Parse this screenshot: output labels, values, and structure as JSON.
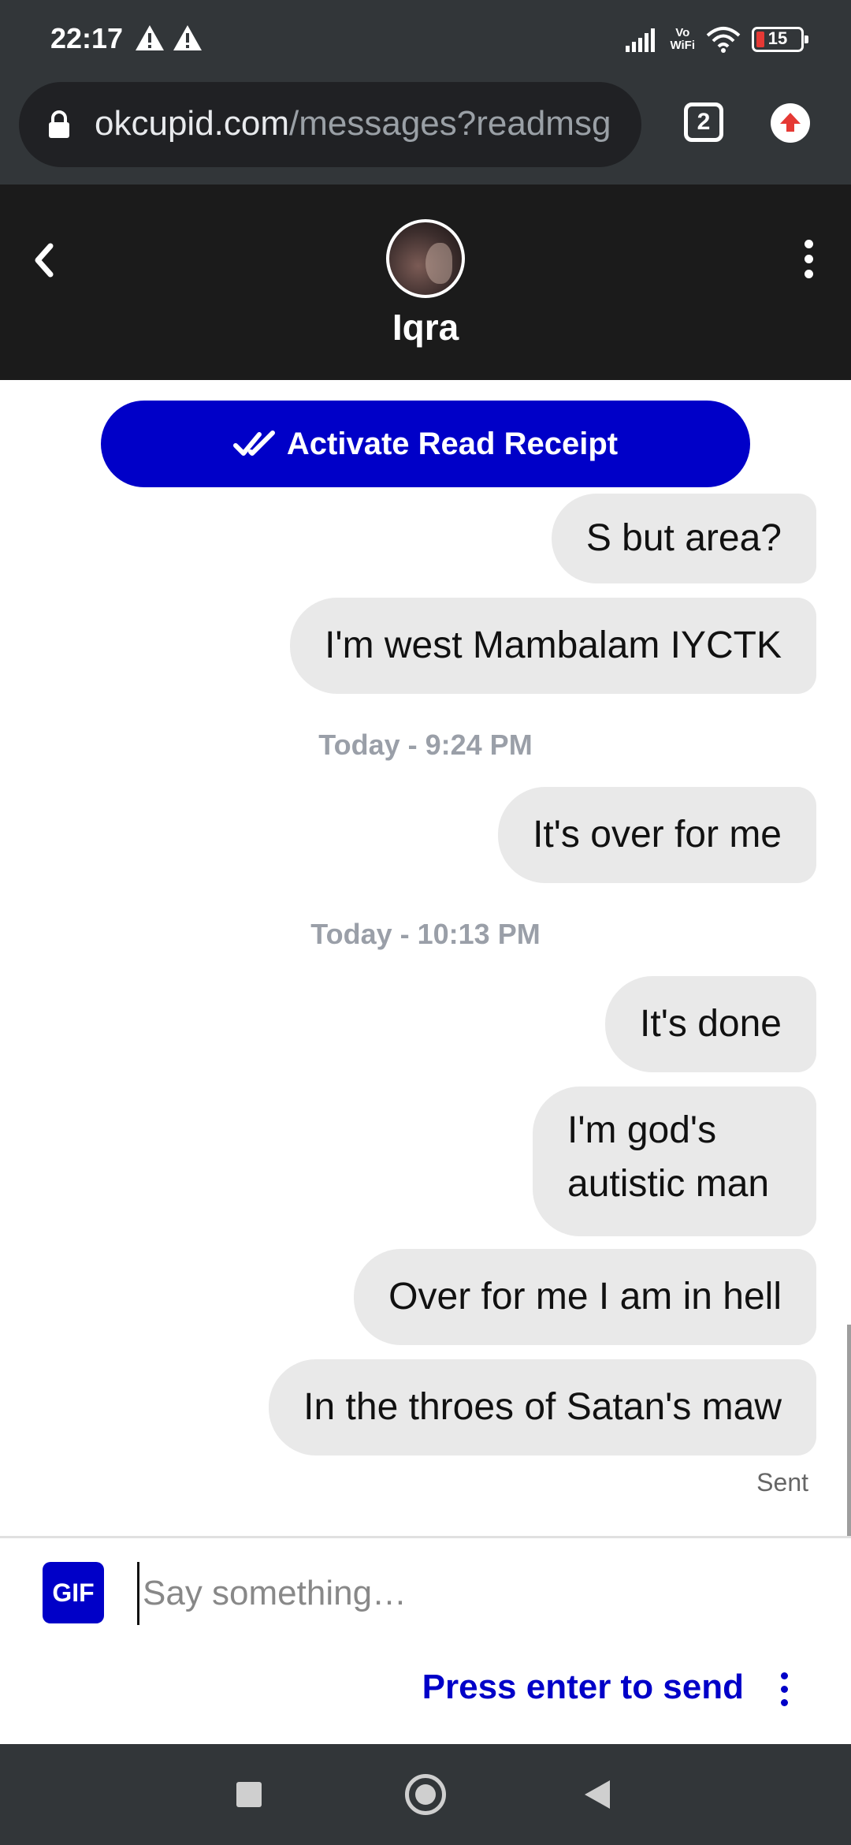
{
  "status_bar": {
    "time": "22:17",
    "vowifi_top": "Vo",
    "vowifi_bottom": "WiFi",
    "battery": "15"
  },
  "browser": {
    "url_host": "okcupid.com",
    "url_rest": "/messages?readmsg",
    "tab_count": "2"
  },
  "header": {
    "contact_name": "Iqra"
  },
  "read_receipt": {
    "label": "Activate Read Receipt"
  },
  "messages": {
    "m1": "S but area?",
    "m2": "I'm west Mambalam IYCTK",
    "ts1": "Today - 9:24 PM",
    "m3": "It's over for me",
    "ts2": "Today - 10:13 PM",
    "m4": "It's done",
    "m5": "I'm god's autistic man",
    "m6": "Over for me I am in hell",
    "m7": "In the throes of Satan's maw",
    "status": "Sent"
  },
  "composer": {
    "gif_label": "GIF",
    "placeholder": "Say something…",
    "enter_hint": "Press enter to send"
  },
  "colors": {
    "accent": "#0000c8",
    "bubble": "#e9e9e9",
    "header_bg": "#1b1b1b",
    "chrome_bg": "#323639"
  }
}
